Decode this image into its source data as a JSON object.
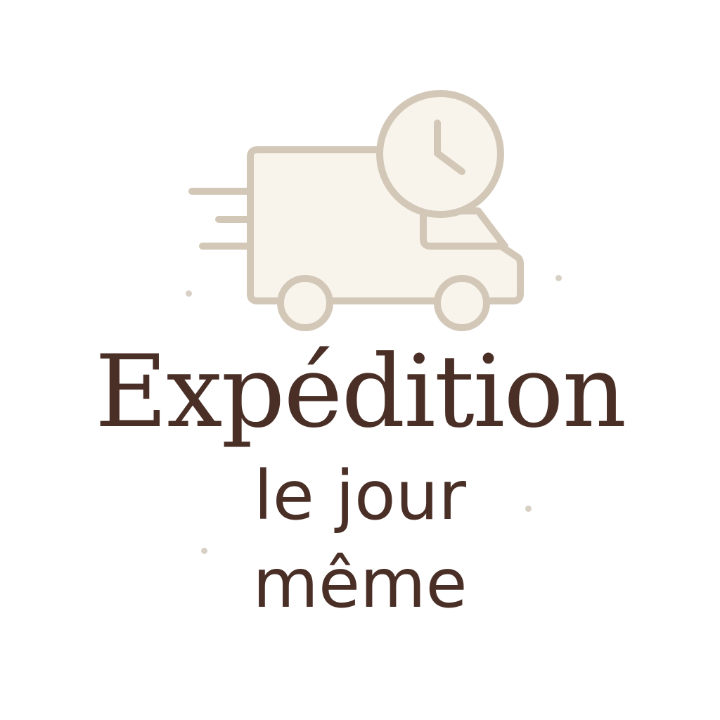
{
  "headline": "Expédition",
  "subline": {
    "line1": "le jour",
    "line2": "même"
  },
  "icons": {
    "vehicle": "delivery-van-icon",
    "clock": "clock-icon",
    "motion": "speed-lines-icon"
  },
  "colors": {
    "background": "#ffffff",
    "text": "#4a2f26",
    "icon_stroke": "#d3c8b8",
    "icon_fill": "#f8f4ec",
    "sparkle": "#d8d0c4"
  }
}
